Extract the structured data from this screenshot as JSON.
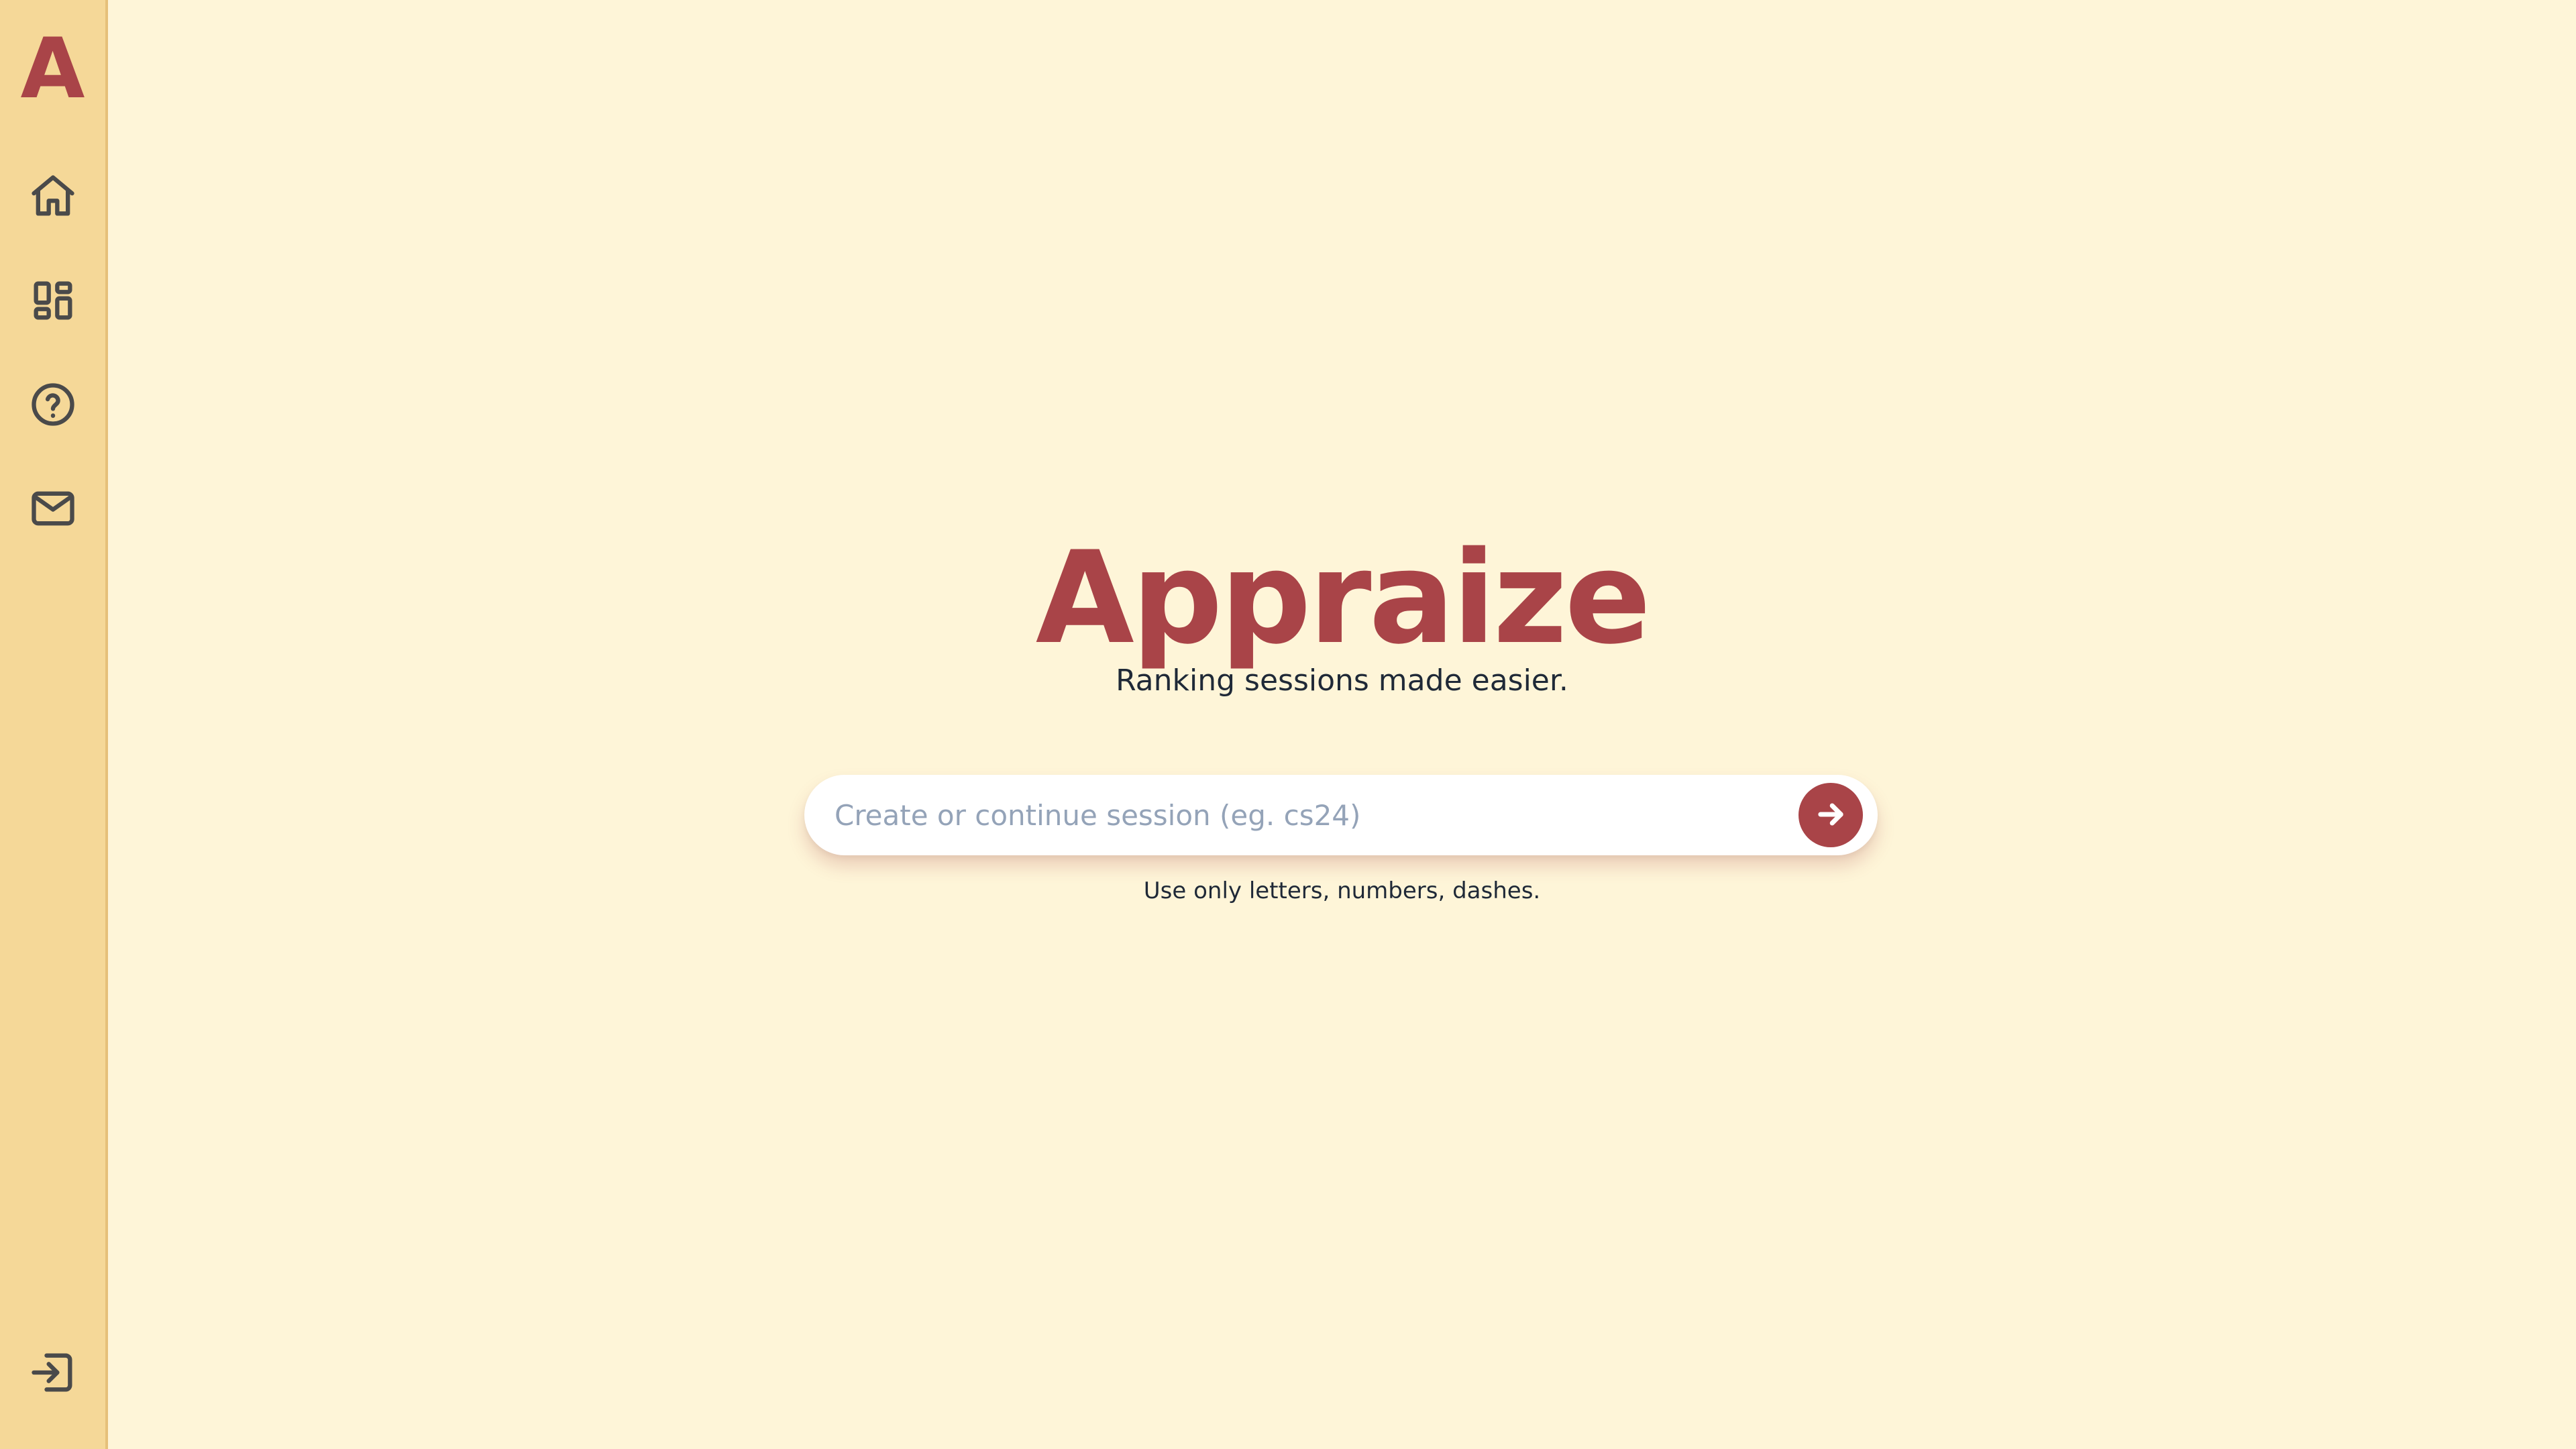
{
  "app": {
    "logo_letter": "A",
    "title": "Appraize",
    "tagline": "Ranking sessions made easier."
  },
  "sidebar": {
    "items": [
      {
        "icon": "home-icon"
      },
      {
        "icon": "dashboard-icon"
      },
      {
        "icon": "help-icon"
      },
      {
        "icon": "mail-icon"
      }
    ],
    "footer_icon": "login-icon"
  },
  "search": {
    "value": "",
    "placeholder": "Create or continue session (eg. cs24)",
    "submit_icon": "arrow-right-icon",
    "hint": "Use only letters, numbers, dashes."
  },
  "colors": {
    "background": "#fef5d8",
    "sidebar": "#f5d898",
    "accent": "#a94448",
    "text": "#1f2937",
    "icon": "#4a4a4a",
    "placeholder": "#94a3b8"
  }
}
